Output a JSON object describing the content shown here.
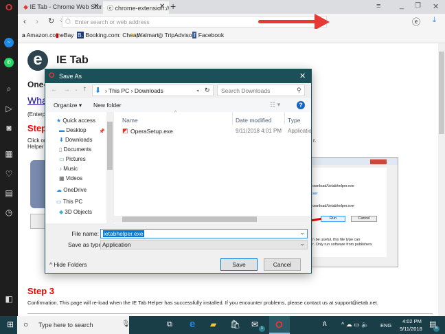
{
  "browser": {
    "tabs": [
      {
        "label": "IE Tab - Chrome Web Store",
        "active": false
      },
      {
        "label": "chrome-extension://hehijb",
        "active": true
      }
    ],
    "address_placeholder": "Enter search or web address",
    "bookmarks": [
      "Amazon.com",
      "eBay",
      "Booking.com: Cheap",
      "Walmart",
      "TripAdvisor",
      "Facebook"
    ],
    "accent": "#e53935"
  },
  "page": {
    "title": "IE Tab",
    "heading_partial": "One-",
    "link_partial": "Wha",
    "note_partial": "(Enterp",
    "step_partial": "Step",
    "text_partial_1": "Click or",
    "text_partial_2": "Helper",
    "text_right": "r.",
    "step3": "Step 3",
    "step3_text": "Confirmation. This page will re-load when the IE Tab Helper has successfully installed. If you encounter problems, please contact us at support@ietab.net."
  },
  "run_dialog": {
    "path1": "ownload/\\ietabhelper.exe",
    "link": "ser",
    "path2": "ownload/\\ietabhelper.exe",
    "run": "Run",
    "cancel": "Cancel",
    "warning1": "n be useful, this file type can",
    "warning2": "r. Only run software from publishers"
  },
  "dialog": {
    "title": "Save As",
    "breadcrumb": [
      "This PC",
      "Downloads"
    ],
    "search_placeholder": "Search Downloads",
    "organize": "Organize ▾",
    "new_folder": "New folder",
    "nav": [
      "Quick access",
      "Desktop",
      "Downloads",
      "Documents",
      "Pictures",
      "Music",
      "Videos",
      "OneDrive",
      "This PC",
      "3D Objects"
    ],
    "columns": [
      "Name",
      "Date modified",
      "Type"
    ],
    "files": [
      {
        "name": "OperaSetup.exe",
        "date": "9/11/2018 4:01 PM",
        "type": "Application"
      }
    ],
    "file_name_label": "File name:",
    "file_name": "ietabhelper.exe",
    "type_label": "Save as type:",
    "type_value": "Application",
    "hide_folders": "Hide Folders",
    "save": "Save",
    "cancel": "Cancel"
  },
  "taskbar": {
    "search_placeholder": "Type here to search",
    "mail_badge": "1",
    "lang": "ENG",
    "time": "4:02 PM",
    "date": "9/11/2018",
    "notif_badge": "5"
  }
}
